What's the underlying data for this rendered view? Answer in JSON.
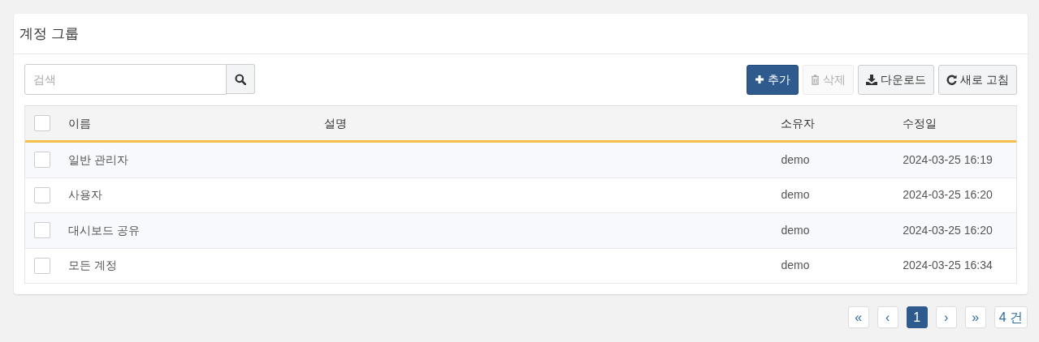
{
  "panel": {
    "title": "계정 그룹"
  },
  "search": {
    "placeholder": "검색"
  },
  "toolbar": [
    {
      "kind": "add",
      "label": "추가",
      "disabled": false
    },
    {
      "kind": "delete",
      "label": "삭제",
      "disabled": true
    },
    {
      "kind": "download",
      "label": "다운로드",
      "disabled": false
    },
    {
      "kind": "refresh",
      "label": "새로 고침",
      "disabled": false
    }
  ],
  "table": {
    "select_all_checked": false,
    "columns": [
      "이름",
      "설명",
      "소유자",
      "수정일"
    ],
    "rows": [
      {
        "checked": false,
        "cells": [
          "일반 관리자",
          "",
          "demo",
          "2024-03-25 16:19"
        ]
      },
      {
        "checked": false,
        "cells": [
          "사용자",
          "",
          "demo",
          "2024-03-25 16:20"
        ]
      },
      {
        "checked": false,
        "cells": [
          "대시보드 공유",
          "",
          "demo",
          "2024-03-25 16:20"
        ]
      },
      {
        "checked": false,
        "cells": [
          "모든 계정",
          "",
          "demo",
          "2024-03-25 16:34"
        ]
      }
    ]
  },
  "pagination": [
    {
      "label": "«",
      "selected": false
    },
    {
      "label": "‹",
      "selected": false
    },
    {
      "label": "1",
      "selected": true
    },
    {
      "label": "›",
      "selected": false
    },
    {
      "label": "»",
      "selected": false
    }
  ],
  "total": "4 건"
}
